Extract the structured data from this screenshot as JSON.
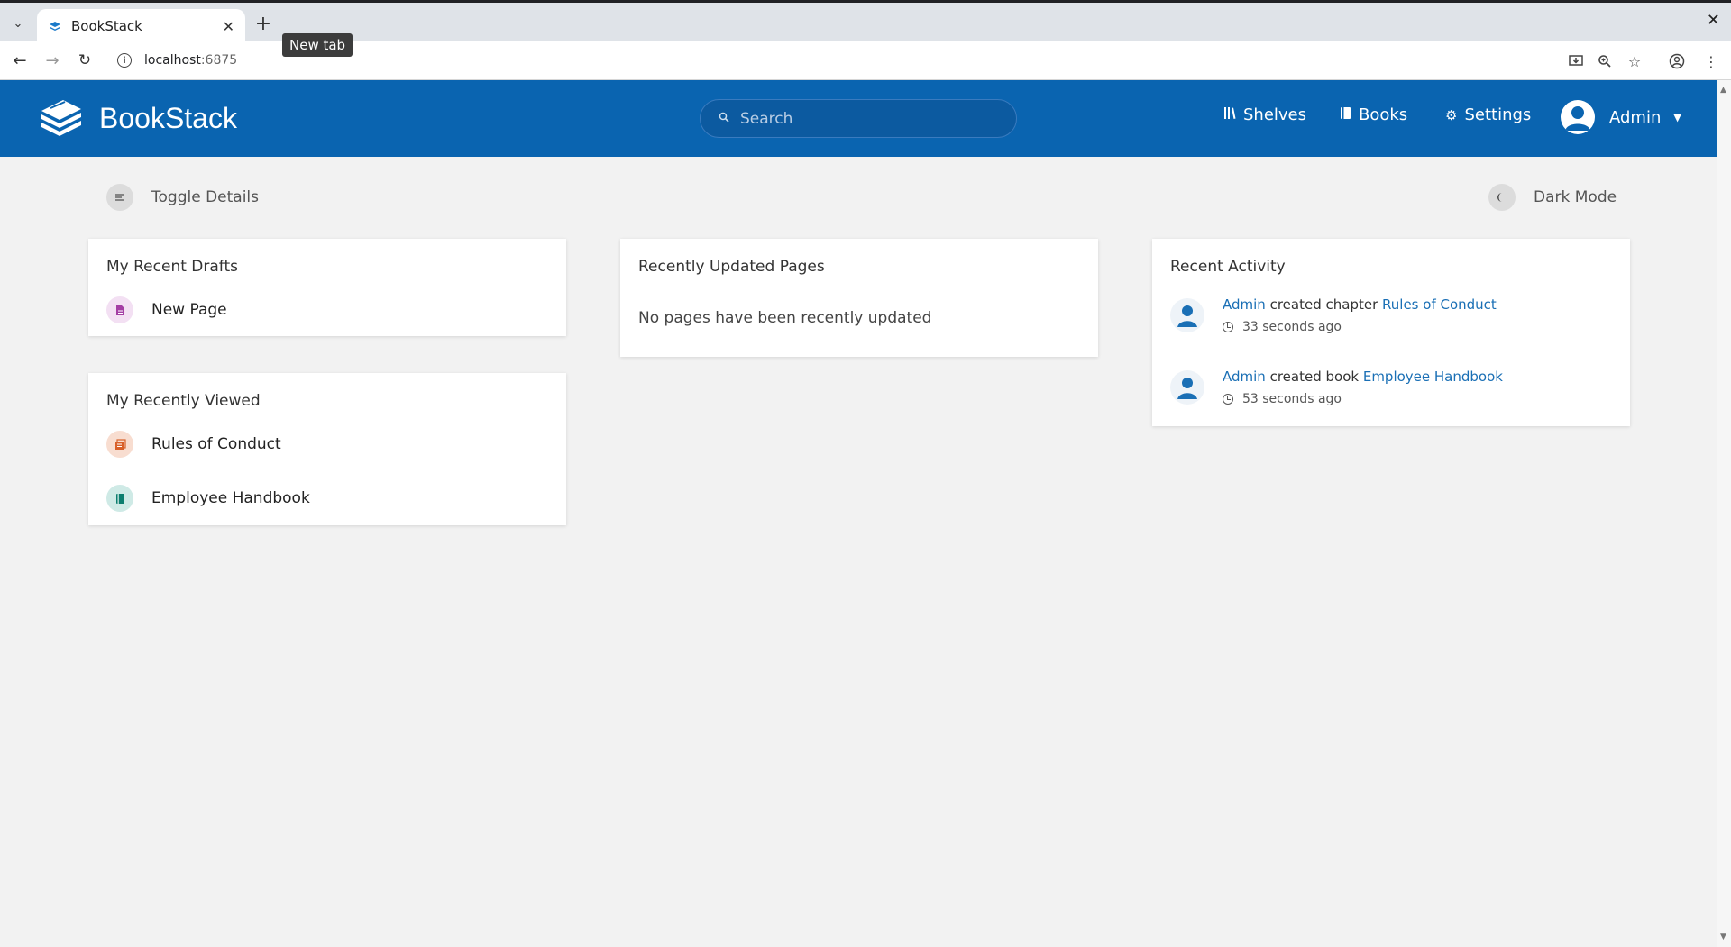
{
  "browser": {
    "tab_title": "BookStack",
    "tooltip": "New tab",
    "url_host": "localhost",
    "url_port": ":6875"
  },
  "header": {
    "app_name": "BookStack",
    "search_placeholder": "Search",
    "nav": {
      "shelves": "Shelves",
      "books": "Books",
      "settings": "Settings"
    },
    "user_name": "Admin",
    "brand_color": "#0a64b0"
  },
  "actions": {
    "toggle_details": "Toggle Details",
    "dark_mode": "Dark Mode"
  },
  "drafts": {
    "title": "My Recent Drafts",
    "items": [
      {
        "label": "New Page",
        "type": "page"
      }
    ]
  },
  "recently_viewed": {
    "title": "My Recently Viewed",
    "items": [
      {
        "label": "Rules of Conduct",
        "type": "chapter"
      },
      {
        "label": "Employee Handbook",
        "type": "book"
      }
    ]
  },
  "updated_pages": {
    "title": "Recently Updated Pages",
    "empty_text": "No pages have been recently updated"
  },
  "activity": {
    "title": "Recent Activity",
    "items": [
      {
        "user": "Admin",
        "action": "created chapter",
        "target": "Rules of Conduct",
        "time": "33 seconds ago"
      },
      {
        "user": "Admin",
        "action": "created book",
        "target": "Employee Handbook",
        "time": "53 seconds ago"
      }
    ]
  }
}
